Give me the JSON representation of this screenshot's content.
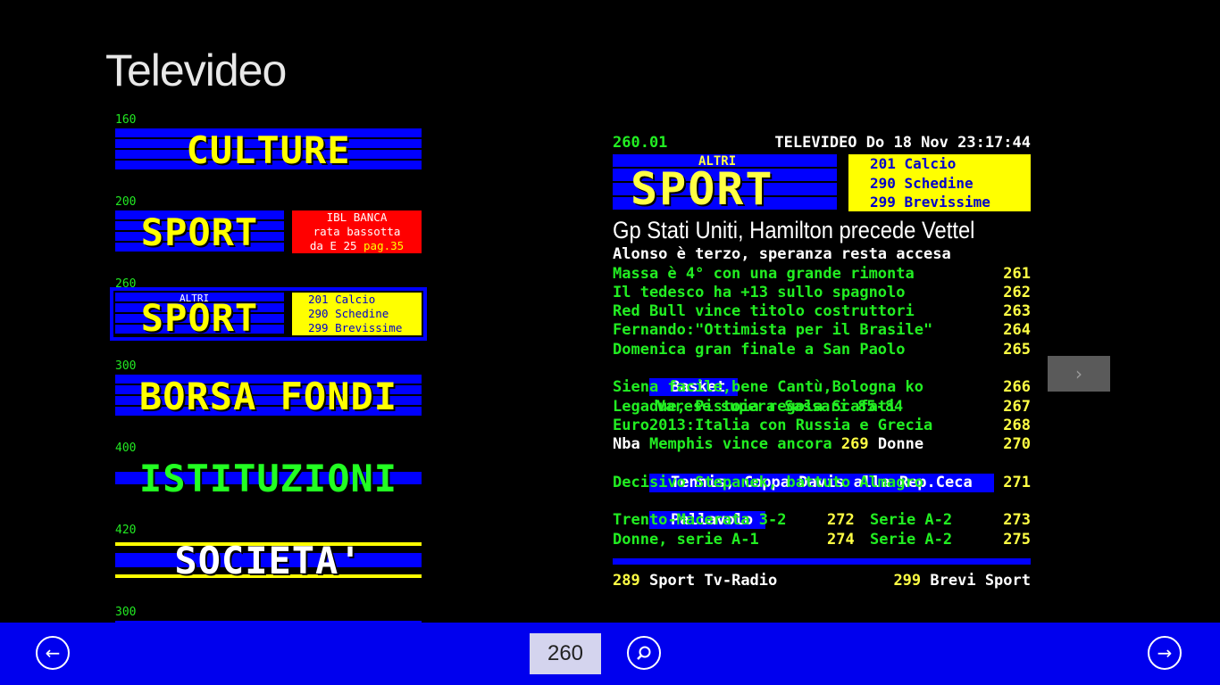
{
  "app": {
    "title": "Televideo"
  },
  "thumbnails": [
    {
      "page": "160",
      "label": "CULTURE"
    },
    {
      "page": "200",
      "label": "SPORT",
      "ad": [
        "IBL BANCA",
        "rata bassotta",
        "da E 25 "
      ],
      "ad_suffix": "pag.35"
    },
    {
      "page": "260",
      "label": "SPORT",
      "altri": "ALTRI",
      "links": [
        "201 Calcio",
        "290 Schedine",
        "299 Brevissime"
      ]
    },
    {
      "page": "300",
      "label": "BORSA FONDI"
    },
    {
      "page": "400",
      "label": "ISTITUZIONI"
    },
    {
      "page": "420",
      "label": "SOCIETA'"
    },
    {
      "page": "300",
      "label": ""
    }
  ],
  "teletext": {
    "page_code": "260.01",
    "header_info": "TELEVIDEO Do 18 Nov 23:17:44",
    "logo_altri": "ALTRI",
    "logo_sport": "SPORT",
    "logo_links": [
      "201 Calcio",
      "290 Schedine",
      "299 Brevissime"
    ],
    "headline": "Gp Stati Uniti, Hamilton precede Vettel",
    "subhead": "Alonso è terzo, speranza resta accesa",
    "f1_items": [
      {
        "text": "Massa è 4° con una grande rimonta",
        "page": "261"
      },
      {
        "text": "Il tedesco ha +13 sullo spagnolo",
        "page": "262"
      },
      {
        "text": "Red Bull vince titolo costruttori",
        "page": "263"
      },
      {
        "text": "Fernando:\"Ottimista per il Brasile\"",
        "page": "264"
      },
      {
        "text": "Domenica gran finale a San Paolo",
        "page": "265"
      }
    ],
    "basket_tag": "Basket",
    "basket_head": "Varese supera Sassari 85-84",
    "basket_items": [
      {
        "text": "Siena facile,bene Cantù,Bologna ko",
        "page": "266"
      },
      {
        "text": "Legadue, Pistoia regola Scafati",
        "page": "267"
      },
      {
        "text": "Euro2013:Italia con Russia e Grecia",
        "page": "268"
      }
    ],
    "nba_label": "Nba",
    "nba_text": "Memphis vince ancora",
    "nba_page": "269",
    "donne_label": "Donne",
    "donne_page": "270",
    "tennis_line": "Tennis, Coppa Davis alla Rep.Ceca",
    "tennis_text": "Decisivo Stepanek, battuto Almagro",
    "tennis_page": "271",
    "volley_tag": "Pallavolo",
    "volley_rows": [
      {
        "left": "Trento-Macerata 3-2",
        "left_page": "272",
        "right": "Serie A-2",
        "right_page": "273"
      },
      {
        "left": "Donne, serie A-1",
        "left_page": "274",
        "right": "Serie A-2",
        "right_page": "275"
      }
    ],
    "footer_left_page": "289",
    "footer_left_text": "Sport Tv-Radio",
    "footer_right_page": "299",
    "footer_right_text": "Brevi Sport"
  },
  "navigation": {
    "next_label": "›",
    "back_icon": "arrow-left-circle-icon",
    "forward_icon": "arrow-right-circle-icon",
    "search_icon": "search-icon"
  },
  "appbar": {
    "page_value": "260"
  }
}
